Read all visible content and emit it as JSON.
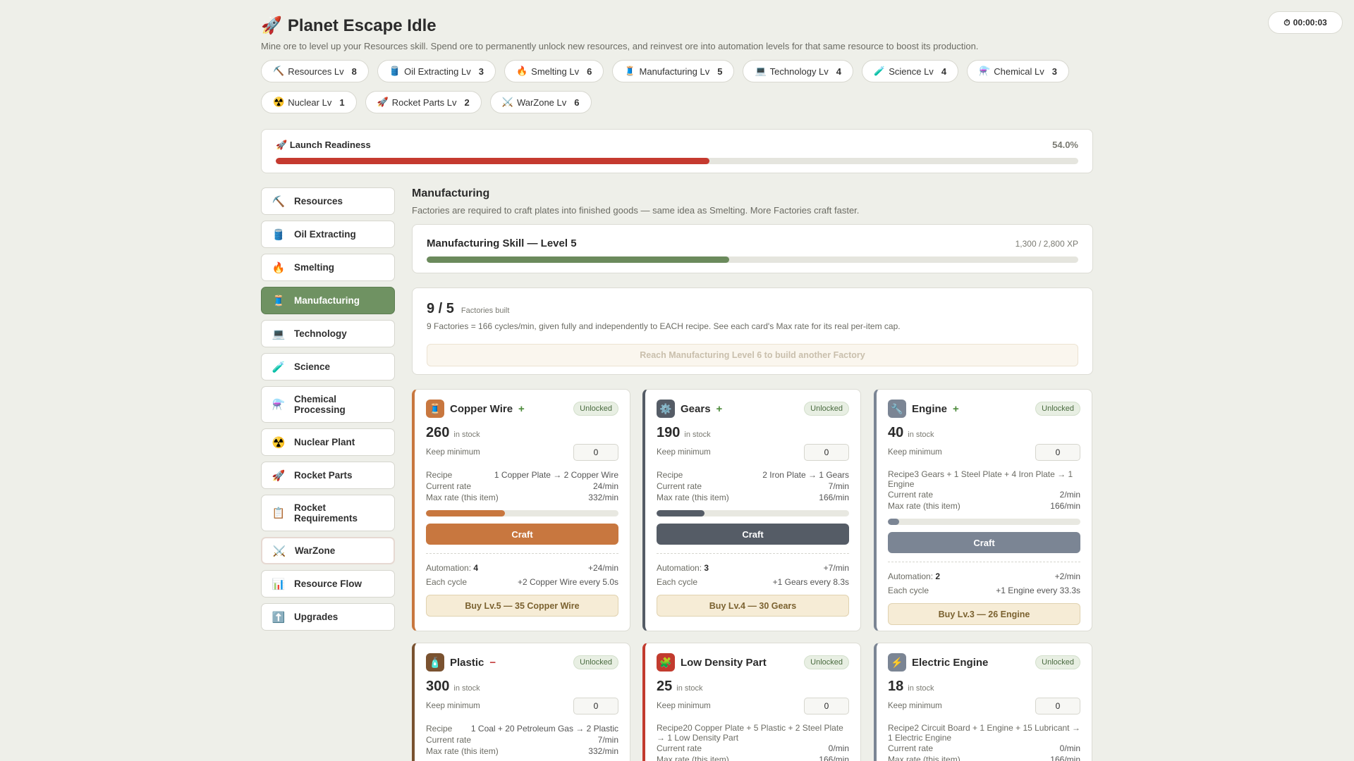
{
  "app": {
    "icon": "🚀",
    "title": "Planet Escape Idle",
    "subtitle": "Mine ore to level up your Resources skill. Spend ore to permanently unlock new resources, and reinvest ore into automation levels for that same resource to boost its production.",
    "timer": "00:00:03",
    "timer_icon": "⏱"
  },
  "skills": [
    {
      "icon": "⛏️",
      "label": "Resources Lv",
      "level": "8"
    },
    {
      "icon": "🛢️",
      "label": "Oil Extracting Lv",
      "level": "3"
    },
    {
      "icon": "🔥",
      "label": "Smelting Lv",
      "level": "6"
    },
    {
      "icon": "🧵",
      "label": "Manufacturing Lv",
      "level": "5"
    },
    {
      "icon": "💻",
      "label": "Technology Lv",
      "level": "4"
    },
    {
      "icon": "🧪",
      "label": "Science Lv",
      "level": "4"
    },
    {
      "icon": "⚗️",
      "label": "Chemical Lv",
      "level": "3"
    },
    {
      "icon": "☢️",
      "label": "Nuclear Lv",
      "level": "1"
    },
    {
      "icon": "🚀",
      "label": "Rocket Parts Lv",
      "level": "2"
    },
    {
      "icon": "⚔️",
      "label": "WarZone Lv",
      "level": "6"
    }
  ],
  "readiness": {
    "icon": "🚀",
    "label": "Launch Readiness",
    "percent_text": "54.0%",
    "fraction": 0.54,
    "color": "#c53a2f"
  },
  "nav": [
    {
      "icon": "⛏️",
      "label": "Resources"
    },
    {
      "icon": "🛢️",
      "label": "Oil Extracting"
    },
    {
      "icon": "🔥",
      "label": "Smelting"
    },
    {
      "icon": "🧵",
      "label": "Manufacturing",
      "active": true
    },
    {
      "icon": "💻",
      "label": "Technology"
    },
    {
      "icon": "🧪",
      "label": "Science"
    },
    {
      "icon": "⚗️",
      "label": "Chemical Processing"
    },
    {
      "icon": "☢️",
      "label": "Nuclear Plant"
    },
    {
      "icon": "🚀",
      "label": "Rocket Parts"
    },
    {
      "icon": "📋",
      "label": "Rocket Requirements"
    },
    {
      "icon": "⚔️",
      "label": "WarZone"
    },
    {
      "icon": "📊",
      "label": "Resource Flow"
    },
    {
      "icon": "⬆️",
      "label": "Upgrades"
    }
  ],
  "section": {
    "title": "Manufacturing",
    "description": "Factories are required to craft plates into finished goods — same idea as Smelting. More Factories craft faster."
  },
  "skill": {
    "name": "Manufacturing Skill — Level 5",
    "xp": "1,300 / 2,800 XP",
    "fraction": 0.464,
    "color": "#6b8a5c"
  },
  "factories": {
    "count": "9 / 5",
    "label": "Factories built",
    "note": "9 Factories = 166 cycles/min, given fully and independently to EACH recipe. See each card's Max rate for its real per-item cap.",
    "locked_text": "Reach Manufacturing Level 6 to build another Factory"
  },
  "labels": {
    "unlocked": "Unlocked",
    "in_stock": "in stock",
    "keep_min": "Keep minimum",
    "recipe": "Recipe",
    "current_rate": "Current rate",
    "max_rate": "Max rate (this item)",
    "craft": "Craft",
    "automation": "Automation:",
    "each_cycle": "Each cycle"
  },
  "cards": [
    {
      "name": "Copper Wire",
      "icon": "🧵",
      "accent": "#c8773f",
      "sign": "+",
      "stock": "260",
      "keep": "0",
      "recipe": "1 Copper Plate → 2 Copper Wire",
      "current_rate": "24/min",
      "max_rate": "332/min",
      "progress": 0.41,
      "automation": "4",
      "auto_rate": "+24/min",
      "cycle": "+2 Copper Wire every 5.0s",
      "buy": "Buy Lv.5 — 35 Copper Wire"
    },
    {
      "name": "Gears",
      "icon": "⚙️",
      "accent": "#555c66",
      "sign": "+",
      "stock": "190",
      "keep": "0",
      "recipe": "2 Iron Plate → 1 Gears",
      "current_rate": "7/min",
      "max_rate": "166/min",
      "progress": 0.25,
      "automation": "3",
      "auto_rate": "+7/min",
      "cycle": "+1 Gears every 8.3s",
      "buy": "Buy Lv.4 — 30 Gears"
    },
    {
      "name": "Engine",
      "icon": "🔧",
      "accent": "#7b8594",
      "sign": "+",
      "stock": "40",
      "keep": "0",
      "recipe": "3 Gears + 1 Steel Plate + 4 Iron Plate → 1 Engine",
      "current_rate": "2/min",
      "max_rate": "166/min",
      "progress": 0.06,
      "automation": "2",
      "auto_rate": "+2/min",
      "cycle": "+1 Engine every 33.3s",
      "buy": "Buy Lv.3 — 26 Engine"
    },
    {
      "name": "Plastic",
      "icon": "🧴",
      "accent": "#7a5230",
      "sign": "−",
      "stock": "300",
      "keep": "0",
      "recipe": "1 Coal + 20 Petroleum Gas → 2 Plastic",
      "current_rate": "7/min",
      "max_rate": "332/min"
    },
    {
      "name": "Low Density Part",
      "icon": "🧩",
      "accent": "#c23b2e",
      "sign": "",
      "stock": "25",
      "keep": "0",
      "recipe": "20 Copper Plate + 5 Plastic + 2 Steel Plate → 1 Low Density Part",
      "current_rate": "0/min",
      "max_rate": "166/min"
    },
    {
      "name": "Electric Engine",
      "icon": "⚡",
      "accent": "#7b8594",
      "sign": "",
      "stock": "18",
      "keep": "0",
      "recipe": "2 Circuit Board + 1 Engine + 15 Lubricant → 1 Electric Engine",
      "current_rate": "0/min",
      "max_rate": "166/min"
    }
  ]
}
